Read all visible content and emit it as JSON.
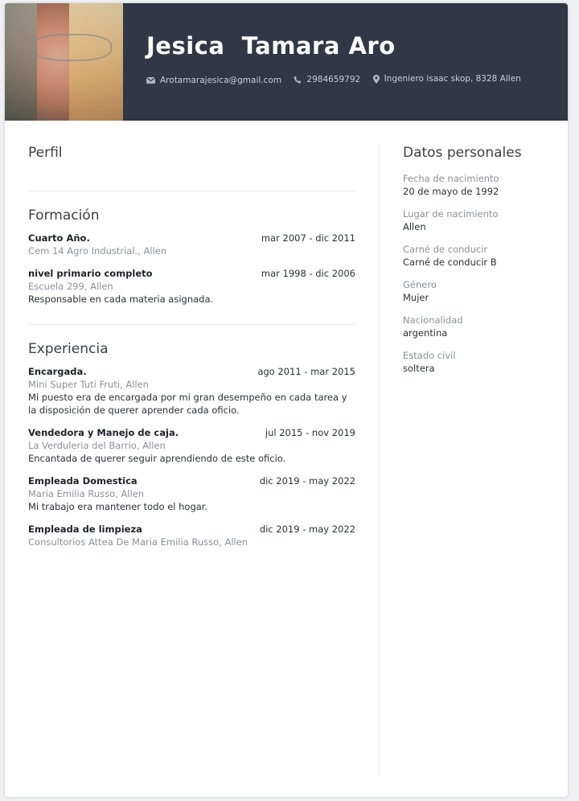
{
  "header": {
    "name": "Jesica  Tamara Aro",
    "email": "Arotamarajesica@gmail.com",
    "phone": "2984659792",
    "address": "Ingeniero isaac skop, 8328 Allen"
  },
  "profile": {
    "title": "Perfil"
  },
  "education": {
    "title": "Formación",
    "items": [
      {
        "title": "Cuarto Año.",
        "date": "mar 2007 - dic 2011",
        "place": "Cem 14 Agro Industrial., Allen",
        "desc": ""
      },
      {
        "title": "nivel primario completo",
        "date": "mar 1998 - dic 2006",
        "place": "Escuela 299, Allen",
        "desc": "Responsable en cada materia asignada."
      }
    ]
  },
  "experience": {
    "title": "Experiencia",
    "items": [
      {
        "title": "Encargada.",
        "date": "ago 2011 - mar 2015",
        "place": "Mini Super Tuti Fruti, Allen",
        "desc": "Mi puesto era de encargada por mi gran desempeño en cada tarea y la disposición de querer aprender cada oficio."
      },
      {
        "title": "Vendedora y Manejo de caja.",
        "date": "jul 2015 - nov 2019",
        "place": "La Verduleria del Barrio, Allen",
        "desc": "Encantada de querer seguir aprendiendo de este oficio."
      },
      {
        "title": "Empleada Domestica",
        "date": "dic 2019 - may 2022",
        "place": "Maria Emilia Russo, Allen",
        "desc": "Mi trabajo era mantener todo el hogar."
      },
      {
        "title": "Empleada de limpieza",
        "date": "dic 2019 - may 2022",
        "place": "Consultorios Attea De Maria Emilia Russo, Allen",
        "desc": ""
      }
    ]
  },
  "personal": {
    "title": "Datos personales",
    "items": [
      {
        "label": "Fecha de nacimiento",
        "value": "20 de mayo de 1992"
      },
      {
        "label": "Lugar de nacimiento",
        "value": "Allen"
      },
      {
        "label": "Carné de conducir",
        "value": "Carné de conducir B"
      },
      {
        "label": "Género",
        "value": "Mujer"
      },
      {
        "label": "Nacionalidad",
        "value": "argentina"
      },
      {
        "label": "Estado civil",
        "value": "soltera"
      }
    ]
  }
}
